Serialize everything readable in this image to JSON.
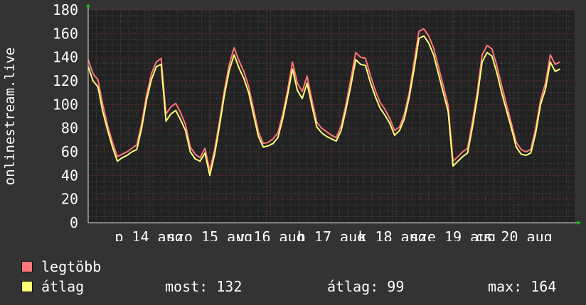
{
  "chart_data": {
    "type": "line",
    "ylabel": "onlinestream.live",
    "ylim": [
      0,
      180
    ],
    "yticks": [
      0,
      20,
      40,
      60,
      80,
      100,
      120,
      140,
      160,
      180
    ],
    "xticks": [
      {
        "pos": 0.125,
        "label": "p 14 aug"
      },
      {
        "pos": 0.25,
        "label": "szo 15 aug"
      },
      {
        "pos": 0.375,
        "label": "v 16 aug"
      },
      {
        "pos": 0.5,
        "label": "h 17 aug"
      },
      {
        "pos": 0.625,
        "label": "k 18 aug"
      },
      {
        "pos": 0.75,
        "label": "sze 19 aug"
      },
      {
        "pos": 0.875,
        "label": "cs 20 aug"
      }
    ],
    "grid": true,
    "x": [
      0,
      0.01,
      0.02,
      0.03,
      0.04,
      0.05,
      0.06,
      0.07,
      0.08,
      0.09,
      0.1,
      0.11,
      0.12,
      0.13,
      0.14,
      0.15,
      0.16,
      0.17,
      0.18,
      0.19,
      0.2,
      0.21,
      0.22,
      0.23,
      0.24,
      0.25,
      0.26,
      0.27,
      0.28,
      0.29,
      0.3,
      0.31,
      0.32,
      0.33,
      0.34,
      0.35,
      0.36,
      0.37,
      0.38,
      0.39,
      0.4,
      0.41,
      0.42,
      0.43,
      0.44,
      0.45,
      0.46,
      0.47,
      0.48,
      0.49,
      0.5,
      0.51,
      0.52,
      0.53,
      0.54,
      0.55,
      0.56,
      0.57,
      0.58,
      0.59,
      0.6,
      0.61,
      0.62,
      0.63,
      0.64,
      0.65,
      0.66,
      0.67,
      0.68,
      0.69,
      0.7,
      0.71,
      0.72,
      0.73,
      0.74,
      0.75,
      0.76,
      0.77,
      0.78,
      0.79,
      0.8,
      0.81,
      0.82,
      0.83,
      0.84,
      0.85,
      0.86,
      0.87,
      0.88,
      0.89,
      0.9,
      0.91,
      0.92,
      0.93,
      0.94,
      0.95,
      0.96,
      0.97,
      0.98,
      0.99,
      1.0
    ],
    "series": [
      {
        "name": "legtöbb",
        "color": "#ff7777",
        "values": [
          138,
          126,
          121,
          100,
          82,
          68,
          56,
          58,
          60,
          63,
          66,
          84,
          108,
          126,
          136,
          139,
          92,
          98,
          101,
          93,
          83,
          64,
          58,
          55,
          63,
          44,
          62,
          86,
          112,
          134,
          148,
          137,
          128,
          115,
          96,
          77,
          67,
          68,
          71,
          76,
          92,
          112,
          136,
          118,
          111,
          124,
          104,
          85,
          80,
          77,
          74,
          72,
          82,
          100,
          122,
          144,
          140,
          139,
          125,
          112,
          102,
          96,
          88,
          78,
          81,
          92,
          110,
          136,
          162,
          164,
          158,
          148,
          132,
          116,
          99,
          52,
          56,
          60,
          63,
          86,
          111,
          142,
          150,
          147,
          133,
          116,
          100,
          84,
          68,
          62,
          60,
          62,
          80,
          104,
          118,
          142,
          134,
          136
        ]
      },
      {
        "name": "átlag",
        "color": "#ffff77",
        "values": [
          132,
          120,
          115,
          94,
          78,
          64,
          52,
          55,
          57,
          60,
          62,
          80,
          104,
          121,
          132,
          134,
          86,
          92,
          95,
          87,
          78,
          60,
          54,
          52,
          59,
          40,
          58,
          82,
          108,
          129,
          142,
          131,
          122,
          110,
          91,
          73,
          64,
          65,
          67,
          72,
          88,
          108,
          130,
          112,
          105,
          118,
          99,
          81,
          76,
          73,
          71,
          69,
          78,
          96,
          116,
          138,
          134,
          133,
          119,
          107,
          97,
          91,
          84,
          74,
          78,
          88,
          106,
          130,
          156,
          158,
          152,
          142,
          126,
          110,
          94,
          48,
          52,
          56,
          59,
          81,
          106,
          136,
          144,
          141,
          127,
          110,
          95,
          80,
          64,
          58,
          57,
          59,
          76,
          100,
          113,
          136,
          128,
          130
        ]
      }
    ]
  },
  "legend": {
    "items": [
      {
        "label": "legtöbb",
        "color": "#ff7777"
      },
      {
        "label": "átlag",
        "color": "#ffff77"
      }
    ],
    "stats": {
      "now": "most: 132",
      "avg": "átlag: 99",
      "max": "max: 164"
    }
  },
  "colors": {
    "background": "#333333",
    "plot_background": "#222222",
    "grid_major": "#6b2c2c",
    "grid_minor": "#4a4a4a",
    "axis": "#dddddd",
    "arrow": "#00cc00"
  }
}
